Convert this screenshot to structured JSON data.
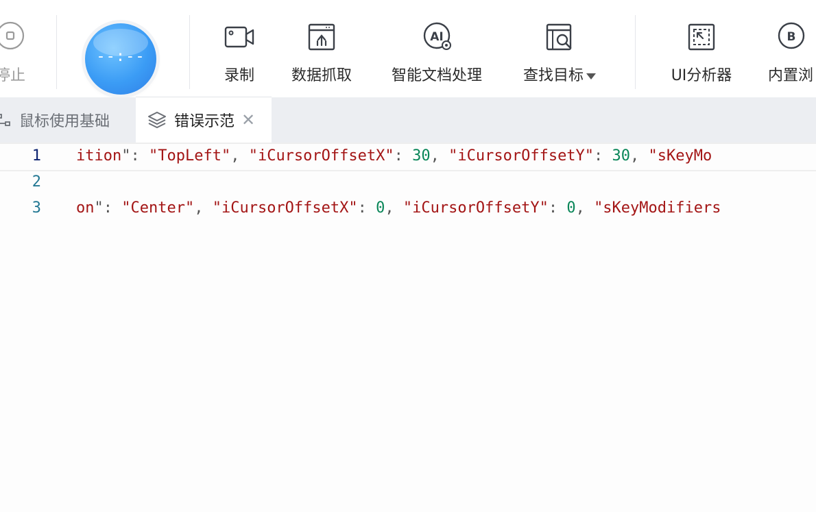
{
  "toolbar": {
    "stop_label": "停止",
    "timer_text": "--:--",
    "buttons": [
      {
        "label": "录制",
        "icon": "record-camera-icon"
      },
      {
        "label": "数据抓取",
        "icon": "data-scrape-icon"
      },
      {
        "label": "智能文档处理",
        "icon": "ai-document-icon"
      },
      {
        "label": "查找目标",
        "icon": "find-target-icon"
      },
      {
        "label": "UI分析器",
        "icon": "ui-analyzer-icon"
      },
      {
        "label": "内置浏",
        "icon": "builtin-browser-icon"
      }
    ]
  },
  "tabs": [
    {
      "label": "鼠标使用基础",
      "active": false,
      "icon": "flow-icon"
    },
    {
      "label": "错误示范",
      "active": true,
      "icon": "layers-icon",
      "close": "✕"
    }
  ],
  "editor": {
    "lines": [
      {
        "num": "1",
        "text": "ition\": \"TopLeft\", \"iCursorOffsetX\": 30, \"iCursorOffsetY\": 30, \"sKeyMo"
      },
      {
        "num": "2",
        "text": ""
      },
      {
        "num": "3",
        "text": "on\": \"Center\", \"iCursorOffsetX\": 0, \"iCursorOffsetY\": 0, \"sKeyModifiers"
      }
    ]
  },
  "colors": {
    "string": "#a31515",
    "number": "#098658",
    "line_number": "#237893",
    "timer": "#3b9cf5"
  }
}
